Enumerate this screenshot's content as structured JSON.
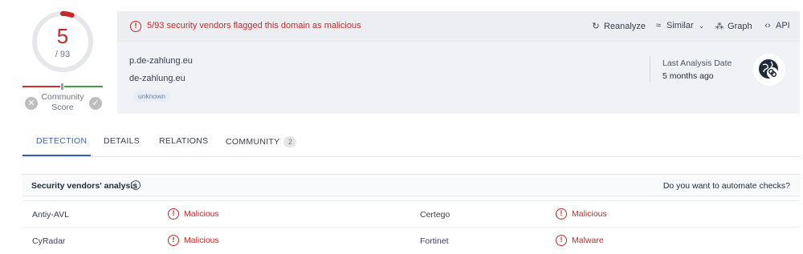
{
  "score": {
    "detections": "5",
    "total": "/ 93",
    "fraction": 0.054,
    "community_label_line1": "Community",
    "community_label_line2": "Score",
    "downvote_icon": "x-icon",
    "upvote_icon": "check-icon"
  },
  "alert": {
    "icon": "alert-circle-icon",
    "text": "5/93 security vendors flagged this domain as malicious"
  },
  "actions": {
    "reanalyze": "Reanalyze",
    "similar": "Similar",
    "graph": "Graph",
    "api": "API"
  },
  "target": {
    "host": "p.de-zahlung.eu",
    "domain": "de-zahlung.eu",
    "tag": "unknown"
  },
  "analysis": {
    "label": "Last Analysis Date",
    "value": "5 months ago",
    "icon": "globe-link-icon"
  },
  "tabs": [
    {
      "label": "DETECTION",
      "active": true
    },
    {
      "label": "DETAILS",
      "active": false
    },
    {
      "label": "RELATIONS",
      "active": false
    },
    {
      "label": "COMMUNITY",
      "active": false,
      "count": "2"
    }
  ],
  "vendors_section": {
    "title": "Security vendors' analysis",
    "automate": "Do you want to automate checks?"
  },
  "vendors": [
    {
      "left_name": "Antiy-AVL",
      "left_verdict": "Malicious",
      "right_name": "Certego",
      "right_verdict": "Malicious"
    },
    {
      "left_name": "CyRadar",
      "left_verdict": "Malicious",
      "right_name": "Fortinet",
      "right_verdict": "Malware"
    }
  ],
  "colors": {
    "malicious": "#c62828",
    "accent": "#3a5fb5",
    "ring_bg": "#e5e7eb"
  }
}
